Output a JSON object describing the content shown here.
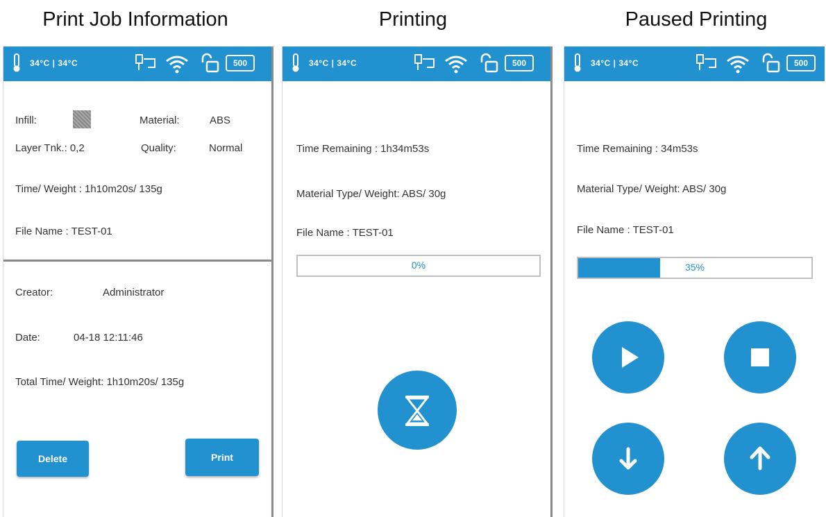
{
  "captions": {
    "info": "Print Job Information",
    "printing": "Printing",
    "paused": "Paused Printing"
  },
  "statusbar": {
    "temp": "34°C | 34°C",
    "badge": "500"
  },
  "info": {
    "infill_label": "Infill:",
    "material_label": "Material:",
    "material_value": "ABS",
    "layer": "Layer Tnk.: 0,2",
    "quality_label": "Quality:",
    "quality_value": "Normal",
    "time_weight": "Time/ Weight :  1h10m20s/ 135g",
    "file_name": "File Name :  TEST-01",
    "creator_label": "Creator:",
    "creator_value": "Administrator",
    "date_label": "Date:",
    "date_value": "04-18 12:11:46",
    "total": "Total Time/ Weight:  1h10m20s/ 135g",
    "delete_label": "Delete",
    "print_label": "Print"
  },
  "printing": {
    "time_remaining": "Time Remaining :  1h34m53s",
    "material": "Material Type/ Weight:  ABS/ 30g",
    "file_name": "File Name : TEST-01",
    "progress_text": "0%",
    "progress": 0
  },
  "paused": {
    "time_remaining": "Time Remaining :  34m53s",
    "material": "Material Type/ Weight:  ABS/ 30g",
    "file_name": "File Name :  TEST-01",
    "progress_text": "35%",
    "progress": 0.35
  },
  "colors": {
    "accent": "#2291cf",
    "divider": "#8a8a8a"
  },
  "icons": {
    "play": "play-icon",
    "stop": "stop-icon",
    "down": "arrow-down-icon",
    "up": "arrow-up-icon",
    "hourglass": "hourglass-icon"
  }
}
